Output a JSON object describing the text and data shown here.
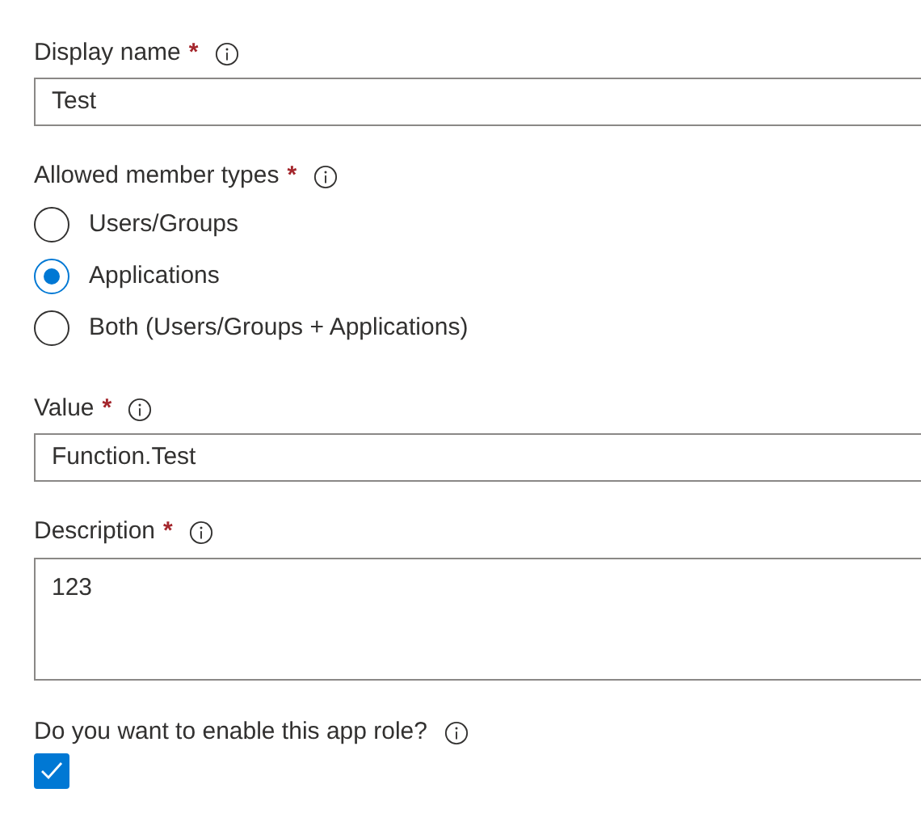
{
  "display_name": {
    "label": "Display name",
    "required_mark": "*",
    "value": "Test"
  },
  "member_types": {
    "label": "Allowed member types",
    "required_mark": "*",
    "options": [
      {
        "label": "Users/Groups",
        "selected": false
      },
      {
        "label": "Applications",
        "selected": true
      },
      {
        "label": "Both (Users/Groups + Applications)",
        "selected": false
      }
    ]
  },
  "value_field": {
    "label": "Value",
    "required_mark": "*",
    "value": "Function.Test"
  },
  "description": {
    "label": "Description",
    "required_mark": "*",
    "value": "123"
  },
  "enable": {
    "label": "Do you want to enable this app role?",
    "checked": true
  }
}
